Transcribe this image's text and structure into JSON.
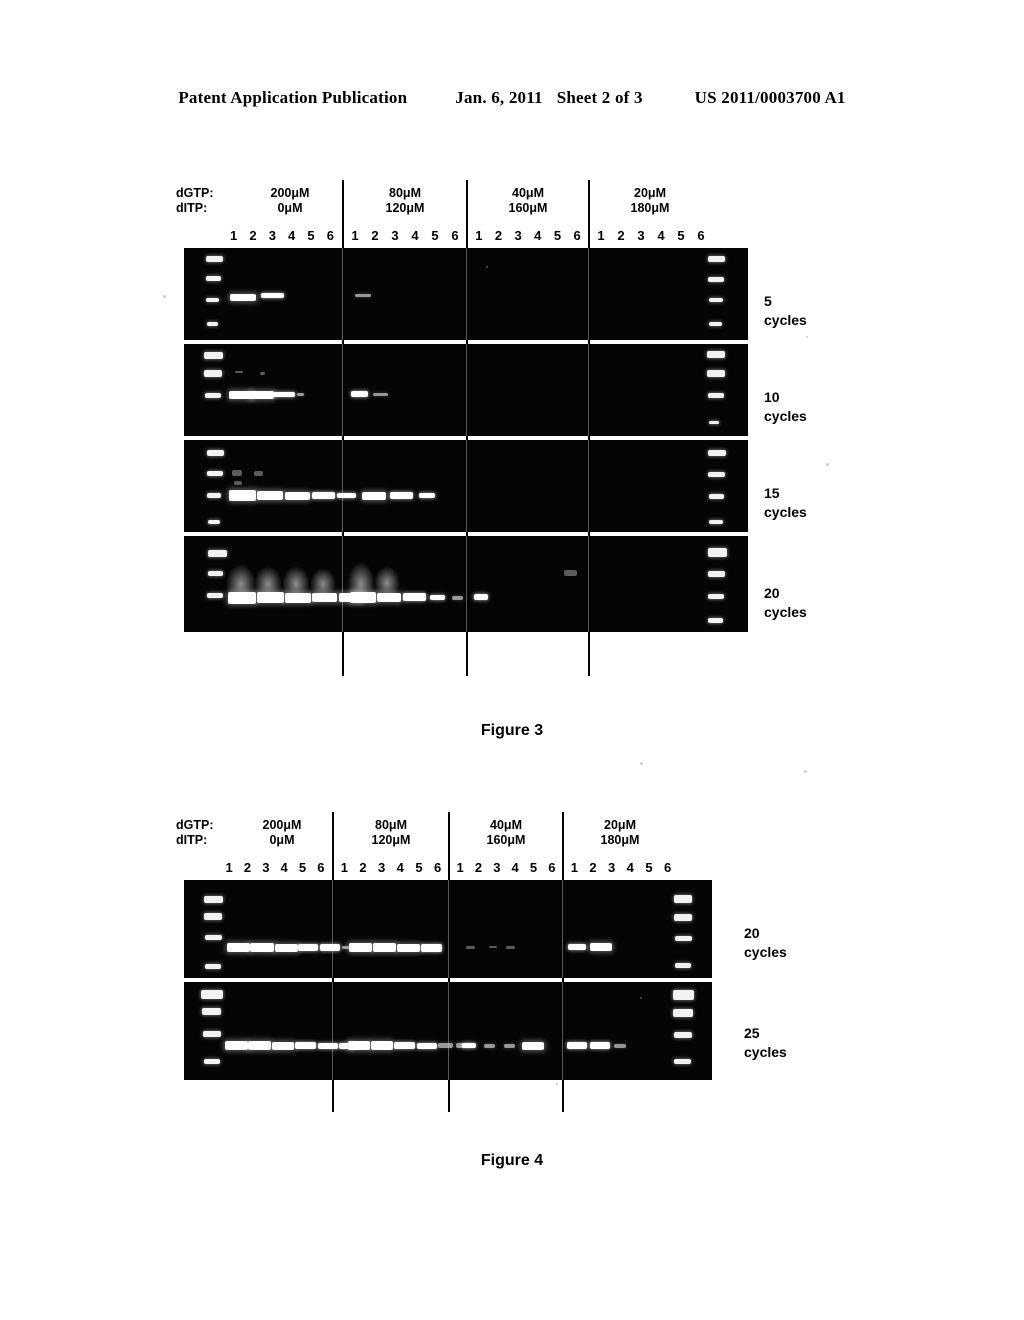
{
  "header": {
    "publication": "Patent Application Publication",
    "date": "Jan. 6, 2011",
    "sheet": "Sheet 2 of 3",
    "patent_number": "US 2011/0003700 A1"
  },
  "figure3": {
    "caption": "Figure 3",
    "row_labels": {
      "dgtp": "dGTP:",
      "ditp": "dITP:"
    },
    "conditions": [
      {
        "dgtp": "200μM",
        "ditp": "0μM"
      },
      {
        "dgtp": "80μM",
        "ditp": "120μM"
      },
      {
        "dgtp": "40μM",
        "ditp": "160μM"
      },
      {
        "dgtp": "20μM",
        "ditp": "180μM"
      }
    ],
    "lane_numbers": [
      "1",
      "2",
      "3",
      "4",
      "5",
      "6"
    ],
    "panels": [
      {
        "cycles": "5\ncycles"
      },
      {
        "cycles": "10\ncycles"
      },
      {
        "cycles": "15\ncycles"
      },
      {
        "cycles": "20\ncycles"
      }
    ]
  },
  "figure4": {
    "caption": "Figure 4",
    "row_labels": {
      "dgtp": "dGTP:",
      "ditp": "dITP:"
    },
    "conditions": [
      {
        "dgtp": "200μM",
        "ditp": "0μM"
      },
      {
        "dgtp": "80μM",
        "ditp": "120μM"
      },
      {
        "dgtp": "40μM",
        "ditp": "160μM"
      },
      {
        "dgtp": "20μM",
        "ditp": "180μM"
      }
    ],
    "lane_numbers": [
      "1",
      "2",
      "3",
      "4",
      "5",
      "6"
    ],
    "panels": [
      {
        "cycles": "20 cycles"
      },
      {
        "cycles": "25 cycles"
      }
    ]
  },
  "colors": {
    "gel_background": "#050505",
    "band": "#ffffff",
    "page_background": "#ffffff",
    "text": "#000000"
  }
}
